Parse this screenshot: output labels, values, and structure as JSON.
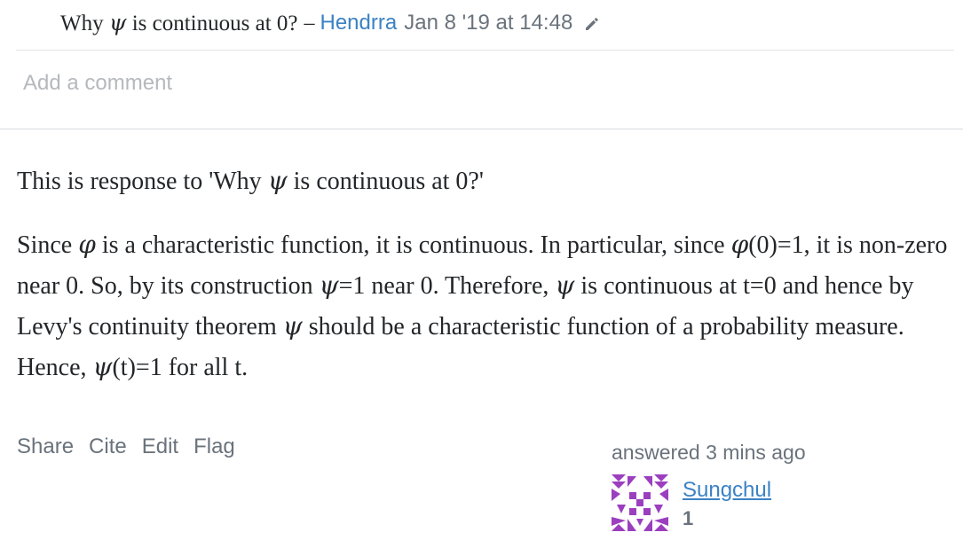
{
  "comment": {
    "text_pre": "Why ",
    "text_math": "ψ",
    "text_post": " is continuous at 0?",
    "separator": "–",
    "user": "Hendrra",
    "date": "Jan 8 '19 at 14:48",
    "edit_icon": "pencil-icon"
  },
  "add_comment_label": "Add a comment",
  "answer": {
    "paragraph1": {
      "a": "This is response to 'Why ",
      "psi": "ψ",
      "b": " is continuous at 0?'"
    },
    "paragraph2": {
      "s1": "Since ",
      "phi1": "φ",
      "s2": " is a characteristic function, it is continuous. In particular, since ",
      "phi2": "φ",
      "s3": "(0)=1, it is non-zero near 0. So, by its construction ",
      "psi1": "ψ",
      "s4": "=1 near 0. Therefore, ",
      "psi2": "ψ",
      "s5": " is continuous at t=0 and hence by Levy's continuity theorem ",
      "psi3": "ψ",
      "s6": " should be a characteristic function of a probability measure. Hence, ",
      "psi4": "ψ",
      "s7": "(t)=1 for all t."
    }
  },
  "post_menu": {
    "share": "Share",
    "cite": "Cite",
    "edit": "Edit",
    "flag": "Flag"
  },
  "signature": {
    "action": "answered 3 mins ago",
    "user_name": "Sungchul",
    "reputation": "1",
    "avatar_icon": "identicon-avatar",
    "avatar_color": "#9b3fbf"
  }
}
